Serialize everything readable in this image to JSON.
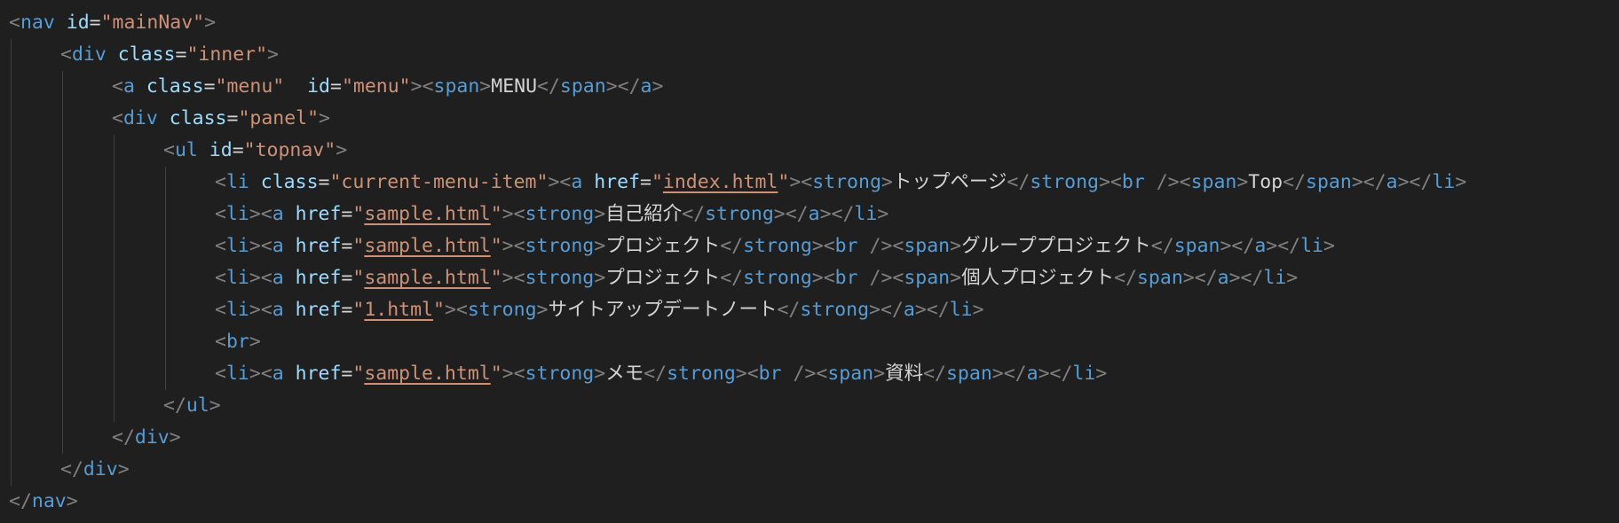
{
  "colors": {
    "background": "#1f1f1f",
    "tag": "#569cd6",
    "punctuation": "#808080",
    "attribute": "#9cdcfe",
    "string": "#ce9178",
    "text": "#d4d4d4",
    "indent_guide": "#404040"
  },
  "code_lines": [
    {
      "indent": 0,
      "tokens": [
        [
          "pun",
          "<"
        ],
        [
          "tag",
          "nav"
        ],
        [
          "txt",
          " "
        ],
        [
          "attr",
          "id"
        ],
        [
          "txt",
          "="
        ],
        [
          "val",
          "\"mainNav\""
        ],
        [
          "pun",
          ">"
        ]
      ]
    },
    {
      "indent": 1,
      "tokens": [
        [
          "pun",
          "<"
        ],
        [
          "tag",
          "div"
        ],
        [
          "txt",
          " "
        ],
        [
          "attr",
          "class"
        ],
        [
          "txt",
          "="
        ],
        [
          "val",
          "\"inner\""
        ],
        [
          "pun",
          ">"
        ]
      ]
    },
    {
      "indent": 2,
      "tokens": [
        [
          "pun",
          "<"
        ],
        [
          "tag",
          "a"
        ],
        [
          "txt",
          " "
        ],
        [
          "attr",
          "class"
        ],
        [
          "txt",
          "="
        ],
        [
          "val",
          "\"menu\""
        ],
        [
          "txt",
          "  "
        ],
        [
          "attr",
          "id"
        ],
        [
          "txt",
          "="
        ],
        [
          "val",
          "\"menu\""
        ],
        [
          "pun",
          "><"
        ],
        [
          "tag",
          "span"
        ],
        [
          "pun",
          ">"
        ],
        [
          "txt",
          "MENU"
        ],
        [
          "pun",
          "</"
        ],
        [
          "tag",
          "span"
        ],
        [
          "pun",
          "></"
        ],
        [
          "tag",
          "a"
        ],
        [
          "pun",
          ">"
        ]
      ]
    },
    {
      "indent": 2,
      "tokens": [
        [
          "pun",
          "<"
        ],
        [
          "tag",
          "div"
        ],
        [
          "txt",
          " "
        ],
        [
          "attr",
          "class"
        ],
        [
          "txt",
          "="
        ],
        [
          "val",
          "\"panel\""
        ],
        [
          "pun",
          ">"
        ]
      ]
    },
    {
      "indent": 3,
      "tokens": [
        [
          "pun",
          "<"
        ],
        [
          "tag",
          "ul"
        ],
        [
          "txt",
          " "
        ],
        [
          "attr",
          "id"
        ],
        [
          "txt",
          "="
        ],
        [
          "val",
          "\"topnav\""
        ],
        [
          "pun",
          ">"
        ]
      ]
    },
    {
      "indent": 4,
      "tokens": [
        [
          "pun",
          "<"
        ],
        [
          "tag",
          "li"
        ],
        [
          "txt",
          " "
        ],
        [
          "attr",
          "class"
        ],
        [
          "txt",
          "="
        ],
        [
          "val",
          "\"current-menu-item\""
        ],
        [
          "pun",
          "><"
        ],
        [
          "tag",
          "a"
        ],
        [
          "txt",
          " "
        ],
        [
          "attr",
          "href"
        ],
        [
          "txt",
          "="
        ],
        [
          "val",
          "\""
        ],
        [
          "link",
          "index.html"
        ],
        [
          "val",
          "\""
        ],
        [
          "pun",
          "><"
        ],
        [
          "tag",
          "strong"
        ],
        [
          "pun",
          ">"
        ],
        [
          "txt",
          "トップページ"
        ],
        [
          "pun",
          "</"
        ],
        [
          "tag",
          "strong"
        ],
        [
          "pun",
          "><"
        ],
        [
          "tag",
          "br"
        ],
        [
          "txt",
          " "
        ],
        [
          "pun",
          "/><"
        ],
        [
          "tag",
          "span"
        ],
        [
          "pun",
          ">"
        ],
        [
          "txt",
          "Top"
        ],
        [
          "pun",
          "</"
        ],
        [
          "tag",
          "span"
        ],
        [
          "pun",
          "></"
        ],
        [
          "tag",
          "a"
        ],
        [
          "pun",
          "></"
        ],
        [
          "tag",
          "li"
        ],
        [
          "pun",
          ">"
        ]
      ]
    },
    {
      "indent": 4,
      "tokens": [
        [
          "pun",
          "<"
        ],
        [
          "tag",
          "li"
        ],
        [
          "pun",
          "><"
        ],
        [
          "tag",
          "a"
        ],
        [
          "txt",
          " "
        ],
        [
          "attr",
          "href"
        ],
        [
          "txt",
          "="
        ],
        [
          "val",
          "\""
        ],
        [
          "link",
          "sample.html"
        ],
        [
          "val",
          "\""
        ],
        [
          "pun",
          "><"
        ],
        [
          "tag",
          "strong"
        ],
        [
          "pun",
          ">"
        ],
        [
          "txt",
          "自己紹介"
        ],
        [
          "pun",
          "</"
        ],
        [
          "tag",
          "strong"
        ],
        [
          "pun",
          "></"
        ],
        [
          "tag",
          "a"
        ],
        [
          "pun",
          "></"
        ],
        [
          "tag",
          "li"
        ],
        [
          "pun",
          ">"
        ]
      ]
    },
    {
      "indent": 4,
      "tokens": [
        [
          "pun",
          "<"
        ],
        [
          "tag",
          "li"
        ],
        [
          "pun",
          "><"
        ],
        [
          "tag",
          "a"
        ],
        [
          "txt",
          " "
        ],
        [
          "attr",
          "href"
        ],
        [
          "txt",
          "="
        ],
        [
          "val",
          "\""
        ],
        [
          "link",
          "sample.html"
        ],
        [
          "val",
          "\""
        ],
        [
          "pun",
          "><"
        ],
        [
          "tag",
          "strong"
        ],
        [
          "pun",
          ">"
        ],
        [
          "txt",
          "プロジェクト"
        ],
        [
          "pun",
          "</"
        ],
        [
          "tag",
          "strong"
        ],
        [
          "pun",
          "><"
        ],
        [
          "tag",
          "br"
        ],
        [
          "txt",
          " "
        ],
        [
          "pun",
          "/><"
        ],
        [
          "tag",
          "span"
        ],
        [
          "pun",
          ">"
        ],
        [
          "txt",
          "グループプロジェクト"
        ],
        [
          "pun",
          "</"
        ],
        [
          "tag",
          "span"
        ],
        [
          "pun",
          "></"
        ],
        [
          "tag",
          "a"
        ],
        [
          "pun",
          "></"
        ],
        [
          "tag",
          "li"
        ],
        [
          "pun",
          ">"
        ]
      ]
    },
    {
      "indent": 4,
      "tokens": [
        [
          "pun",
          "<"
        ],
        [
          "tag",
          "li"
        ],
        [
          "pun",
          "><"
        ],
        [
          "tag",
          "a"
        ],
        [
          "txt",
          " "
        ],
        [
          "attr",
          "href"
        ],
        [
          "txt",
          "="
        ],
        [
          "val",
          "\""
        ],
        [
          "link",
          "sample.html"
        ],
        [
          "val",
          "\""
        ],
        [
          "pun",
          "><"
        ],
        [
          "tag",
          "strong"
        ],
        [
          "pun",
          ">"
        ],
        [
          "txt",
          "プロジェクト"
        ],
        [
          "pun",
          "</"
        ],
        [
          "tag",
          "strong"
        ],
        [
          "pun",
          "><"
        ],
        [
          "tag",
          "br"
        ],
        [
          "txt",
          " "
        ],
        [
          "pun",
          "/><"
        ],
        [
          "tag",
          "span"
        ],
        [
          "pun",
          ">"
        ],
        [
          "txt",
          "個人プロジェクト"
        ],
        [
          "pun",
          "</"
        ],
        [
          "tag",
          "span"
        ],
        [
          "pun",
          "></"
        ],
        [
          "tag",
          "a"
        ],
        [
          "pun",
          "></"
        ],
        [
          "tag",
          "li"
        ],
        [
          "pun",
          ">"
        ]
      ]
    },
    {
      "indent": 4,
      "tokens": [
        [
          "pun",
          "<"
        ],
        [
          "tag",
          "li"
        ],
        [
          "pun",
          "><"
        ],
        [
          "tag",
          "a"
        ],
        [
          "txt",
          " "
        ],
        [
          "attr",
          "href"
        ],
        [
          "txt",
          "="
        ],
        [
          "val",
          "\""
        ],
        [
          "link",
          "1.html"
        ],
        [
          "val",
          "\""
        ],
        [
          "pun",
          "><"
        ],
        [
          "tag",
          "strong"
        ],
        [
          "pun",
          ">"
        ],
        [
          "txt",
          "サイトアップデートノート"
        ],
        [
          "pun",
          "</"
        ],
        [
          "tag",
          "strong"
        ],
        [
          "pun",
          "></"
        ],
        [
          "tag",
          "a"
        ],
        [
          "pun",
          "></"
        ],
        [
          "tag",
          "li"
        ],
        [
          "pun",
          ">"
        ]
      ]
    },
    {
      "indent": 4,
      "tokens": [
        [
          "pun",
          "<"
        ],
        [
          "tag",
          "br"
        ],
        [
          "pun",
          ">"
        ]
      ]
    },
    {
      "indent": 4,
      "tokens": [
        [
          "pun",
          "<"
        ],
        [
          "tag",
          "li"
        ],
        [
          "pun",
          "><"
        ],
        [
          "tag",
          "a"
        ],
        [
          "txt",
          " "
        ],
        [
          "attr",
          "href"
        ],
        [
          "txt",
          "="
        ],
        [
          "val",
          "\""
        ],
        [
          "link",
          "sample.html"
        ],
        [
          "val",
          "\""
        ],
        [
          "pun",
          "><"
        ],
        [
          "tag",
          "strong"
        ],
        [
          "pun",
          ">"
        ],
        [
          "txt",
          "メモ"
        ],
        [
          "pun",
          "</"
        ],
        [
          "tag",
          "strong"
        ],
        [
          "pun",
          "><"
        ],
        [
          "tag",
          "br"
        ],
        [
          "txt",
          " "
        ],
        [
          "pun",
          "/><"
        ],
        [
          "tag",
          "span"
        ],
        [
          "pun",
          ">"
        ],
        [
          "txt",
          "資料"
        ],
        [
          "pun",
          "</"
        ],
        [
          "tag",
          "span"
        ],
        [
          "pun",
          "></"
        ],
        [
          "tag",
          "a"
        ],
        [
          "pun",
          "></"
        ],
        [
          "tag",
          "li"
        ],
        [
          "pun",
          ">"
        ]
      ]
    },
    {
      "indent": 3,
      "tokens": [
        [
          "pun",
          "</"
        ],
        [
          "tag",
          "ul"
        ],
        [
          "pun",
          ">"
        ]
      ]
    },
    {
      "indent": 2,
      "tokens": [
        [
          "pun",
          "</"
        ],
        [
          "tag",
          "div"
        ],
        [
          "pun",
          ">"
        ]
      ]
    },
    {
      "indent": 1,
      "tokens": [
        [
          "pun",
          "</"
        ],
        [
          "tag",
          "div"
        ],
        [
          "pun",
          ">"
        ]
      ]
    },
    {
      "indent": 0,
      "tokens": [
        [
          "pun",
          "</"
        ],
        [
          "tag",
          "nav"
        ],
        [
          "pun",
          ">"
        ]
      ]
    }
  ]
}
